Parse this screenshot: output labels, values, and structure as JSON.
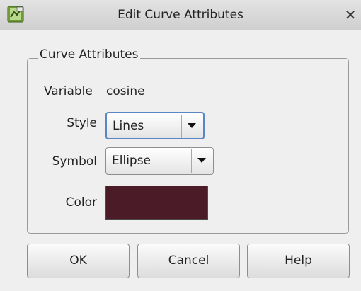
{
  "window": {
    "title": "Edit Curve Attributes",
    "close_glyph": "✕",
    "icon": "app-icon"
  },
  "group": {
    "title": "Curve Attributes"
  },
  "fields": {
    "variable_label": "Variable",
    "variable_value": "cosine",
    "style_label": "Style",
    "style_value": "Lines",
    "symbol_label": "Symbol",
    "symbol_value": "Ellipse",
    "color_label": "Color",
    "color_value": "#4b1c28"
  },
  "buttons": {
    "ok": "OK",
    "cancel": "Cancel",
    "help": "Help"
  }
}
